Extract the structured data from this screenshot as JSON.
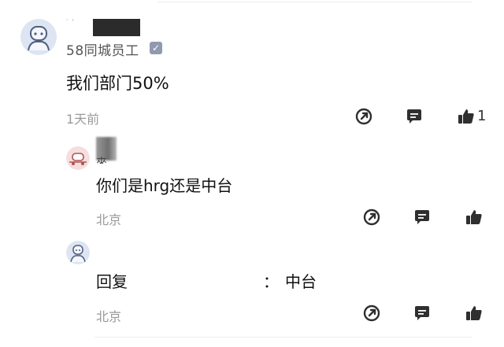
{
  "comment": {
    "username_prefix": "′ ’",
    "badge": "58同城员工",
    "verified_mark": "✓",
    "text": "我们部门50%",
    "time": "1天前",
    "likes": "1"
  },
  "replies": [
    {
      "name_visible": "來",
      "text": "你们是hrg还是中台",
      "location": "北京"
    },
    {
      "prefix": "回复",
      "separator": "：",
      "text": "中台",
      "location": "北京"
    }
  ],
  "icons": {
    "share": "share-icon",
    "reply": "comment-icon",
    "like": "thumbs-up-icon"
  },
  "colors": {
    "icon": "#2f2f2f",
    "meta": "#9a9a9a",
    "avatar_bg": "#dde4f2",
    "avatar_bg_red": "#f6dede"
  }
}
